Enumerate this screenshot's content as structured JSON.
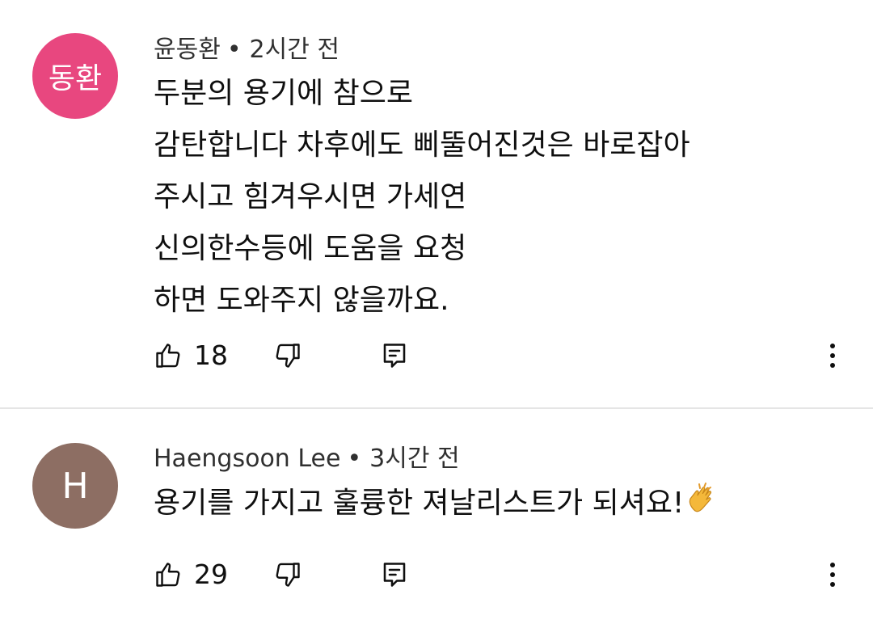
{
  "comments": [
    {
      "avatar_text": "동환",
      "avatar_color": "#e8477f",
      "author": "윤동환",
      "separator": "•",
      "time": "2시간 전",
      "lines": [
        "두분의 용기에 참으로",
        "감탄합니다 차후에도 삐뚤어진것은 바로잡아",
        "주시고 힘겨우시면 가세연",
        "신의한수등에 도움을 요청",
        "하면 도와주지 않을까요."
      ],
      "likes": "18",
      "icons": {
        "like": "thumbs-up-icon",
        "dislike": "thumbs-down-icon",
        "reply": "reply-comment-icon",
        "more": "more-vert-icon"
      }
    },
    {
      "avatar_text": "H",
      "avatar_color": "#8d6e63",
      "author": "Haengsoon Lee",
      "separator": "•",
      "time": "3시간 전",
      "lines": [
        "용기를 가지고 훌륭한 져날리스트가 되셔요!"
      ],
      "emoji": "clapping-hands-emoji",
      "likes": "29",
      "icons": {
        "like": "thumbs-up-icon",
        "dislike": "thumbs-down-icon",
        "reply": "reply-comment-icon",
        "more": "more-vert-icon"
      }
    }
  ]
}
